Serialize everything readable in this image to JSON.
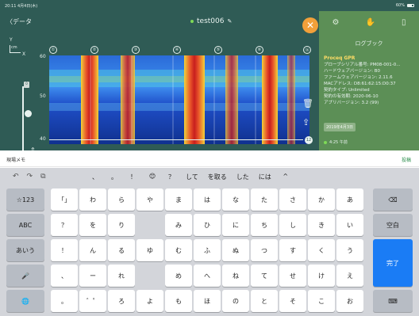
{
  "statusbar": {
    "time": "20:11 4月4日(木)",
    "right": "60%"
  },
  "nav": {
    "back_label": "〈データ",
    "file_name": "test006"
  },
  "panel": {
    "logbook_label": "ログブック",
    "name": "Proceq GPR",
    "lines": [
      "プローブシリアル番号: PM08-001-0...",
      "ハードウェアバージョン: B0",
      "ファームウェアバージョン: 2.11.6",
      "MACアドレス: D8:61:62:15:D0:37",
      "契約タイプ: Unlimited",
      "契約の有効期: 2020-06-10",
      "アプリバージョン: 3.2 (99)"
    ],
    "date_button": "2019年4月3日",
    "time_item": "4:25 午前"
  },
  "axis": {
    "y": "Y",
    "unit": "cm",
    "x": "X",
    "depths": [
      "60",
      "50",
      "40"
    ]
  },
  "markers": [
    "①",
    "②",
    "③",
    "④",
    "⑤",
    "⑥",
    "⑭"
  ],
  "end_marker": "12",
  "memo": {
    "label": "現場メモ",
    "post": "投稿"
  },
  "candidates": {
    "tool_icons": [
      "↶",
      "↷",
      "⧉"
    ],
    "items": [
      "、",
      "。",
      "！",
      "😊",
      "？",
      "して",
      "を取る",
      "した",
      "には",
      "^"
    ]
  },
  "keyboard": {
    "left_keys": [
      "☆123",
      "ABC",
      "あいう",
      "🎤",
      "🌐"
    ],
    "columns": [
      [
        "「」",
        "？",
        "！",
        "、",
        "。"
      ],
      [
        "わ",
        "を",
        "ん",
        "ー",
        "゛゜"
      ],
      [
        "ら",
        "り",
        "る",
        "れ",
        "ろ"
      ],
      [
        "や",
        "",
        "ゆ",
        "",
        "よ"
      ],
      [
        "ま",
        "み",
        "む",
        "め",
        "も"
      ],
      [
        "は",
        "ひ",
        "ふ",
        "へ",
        "ほ"
      ],
      [
        "な",
        "に",
        "ぬ",
        "ね",
        "の"
      ],
      [
        "た",
        "ち",
        "つ",
        "て",
        "と"
      ],
      [
        "さ",
        "し",
        "す",
        "せ",
        "そ"
      ],
      [
        "か",
        "き",
        "く",
        "け",
        "こ"
      ],
      [
        "あ",
        "い",
        "う",
        "え",
        "お"
      ]
    ],
    "right_keys": {
      "delete": "⌫",
      "space": "空白",
      "done": "完了",
      "hide": "⌨"
    }
  },
  "colors": {
    "header": "#2f5b55",
    "panel": "#5c8f56",
    "accent": "#f2a03a",
    "done": "#1a7cf5"
  }
}
